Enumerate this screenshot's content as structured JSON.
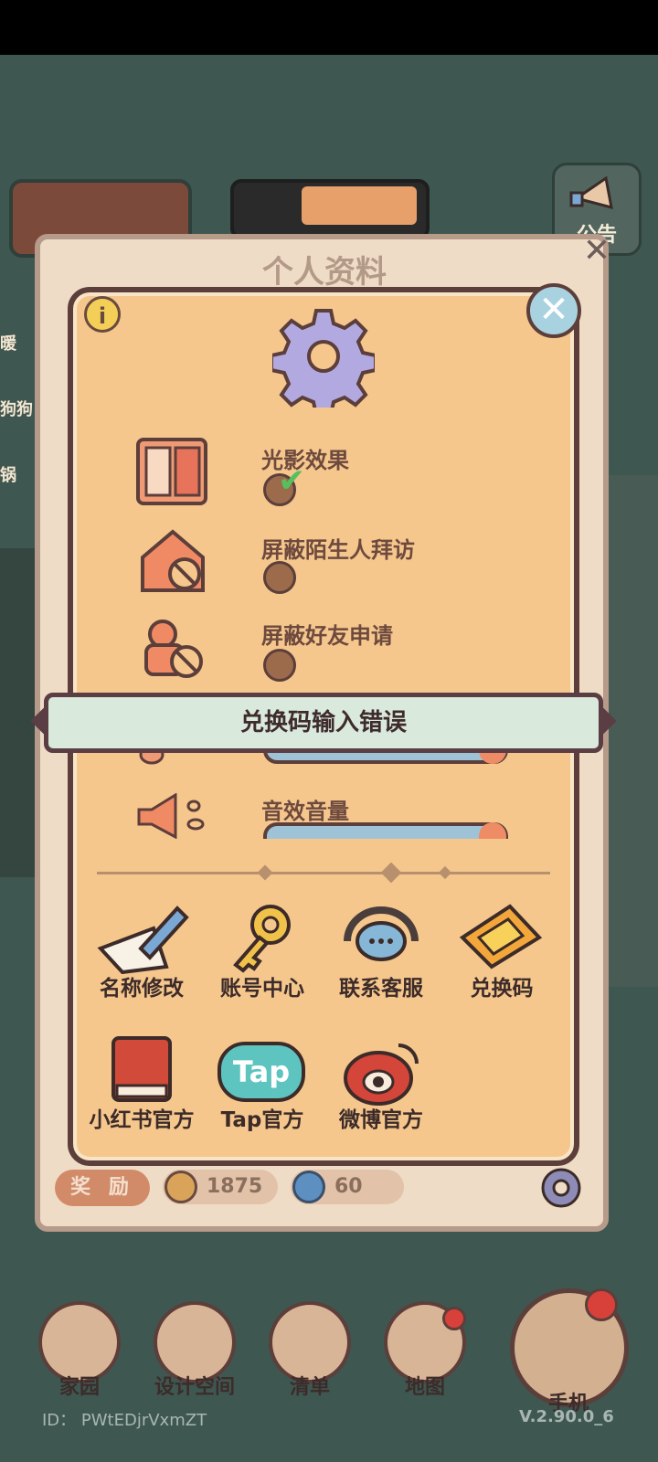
{
  "hud": {
    "notice_label": "公告",
    "side_labels": [
      "暖",
      "狗狗",
      "锅"
    ]
  },
  "profile_panel": {
    "title": "个人资料",
    "reward_label": "奖 励",
    "coin_amount": "1875",
    "gem_amount": "60"
  },
  "settings": {
    "info_label": "i",
    "options": [
      {
        "label": "光影效果",
        "checked": true
      },
      {
        "label": "屏蔽陌生人拜访",
        "checked": false
      },
      {
        "label": "屏蔽好友申请",
        "checked": false
      }
    ],
    "sound_volume_label": "音效音量",
    "grid_row1": [
      "名称修改",
      "账号中心",
      "联系客服",
      "兑换码"
    ],
    "grid_row2": [
      "小红书官方",
      "Tap官方",
      "微博官方"
    ],
    "tap_logo_text": "Tap"
  },
  "toast": {
    "message": "兑换码输入错误"
  },
  "nav": {
    "items": [
      "家园",
      "设计空间",
      "清单",
      "地图"
    ],
    "phone_label": "手机"
  },
  "footer": {
    "id_text": "ID：  PWtEDjrVxmZT",
    "version": "V.2.90.0_6"
  },
  "colors": {
    "dialog_bg": "#f5c78d",
    "toast_bg": "#d9e9dc",
    "accent_green": "#57c05d",
    "badge_red": "#d8413a"
  }
}
